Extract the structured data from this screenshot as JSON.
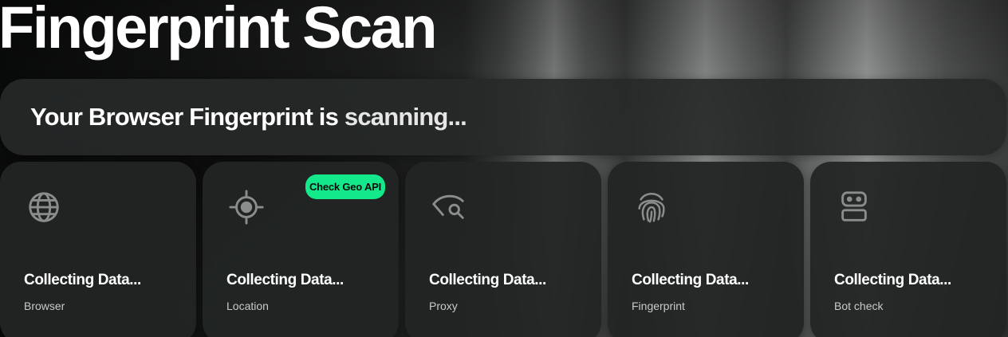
{
  "header": {
    "title": "Fingerprint Scan"
  },
  "status": {
    "text_strong": "Your Browser Fingerprint is",
    "text_light": " scanning..."
  },
  "geo_button": {
    "label": "Check Geo API"
  },
  "cards": [
    {
      "title": "Collecting Data...",
      "subtitle": "Browser",
      "icon": "globe-icon"
    },
    {
      "title": "Collecting Data...",
      "subtitle": "Location",
      "icon": "crosshair-icon"
    },
    {
      "title": "Collecting Data...",
      "subtitle": "Proxy",
      "icon": "eye-search-icon"
    },
    {
      "title": "Collecting Data...",
      "subtitle": "Fingerprint",
      "icon": "fingerprint-icon"
    },
    {
      "title": "Collecting Data...",
      "subtitle": "Bot check",
      "icon": "robot-icon"
    }
  ],
  "colors": {
    "accent": "#13e98a",
    "card_bg": "#222524",
    "icon": "#8a8d8c"
  }
}
